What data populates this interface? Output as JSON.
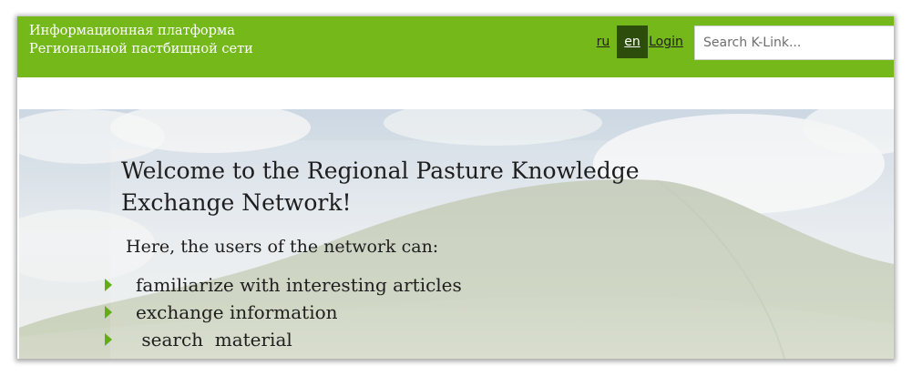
{
  "header": {
    "brand_line1": "Информационная платформа",
    "brand_line2": "Региональной пастбищной сети",
    "languages": [
      {
        "label": "ru",
        "active": false
      },
      {
        "label": "en",
        "active": true
      }
    ],
    "login_label": "Login",
    "search_placeholder": "Search K-Link..."
  },
  "hero": {
    "headline": "Welcome to the Regional Pasture Knowledge Exchange Network!",
    "intro": "Here, the users of the network can:",
    "features": [
      "familiarize with interesting articles",
      "exchange information",
      " search  material"
    ]
  },
  "colors": {
    "header_bg": "#74b81a",
    "active_lang_bg": "#2c4d0c",
    "bullet": "#5fae14",
    "text": "#1e1e1e"
  },
  "icons": {
    "bullet": "green-triangle-bullet-icon"
  }
}
